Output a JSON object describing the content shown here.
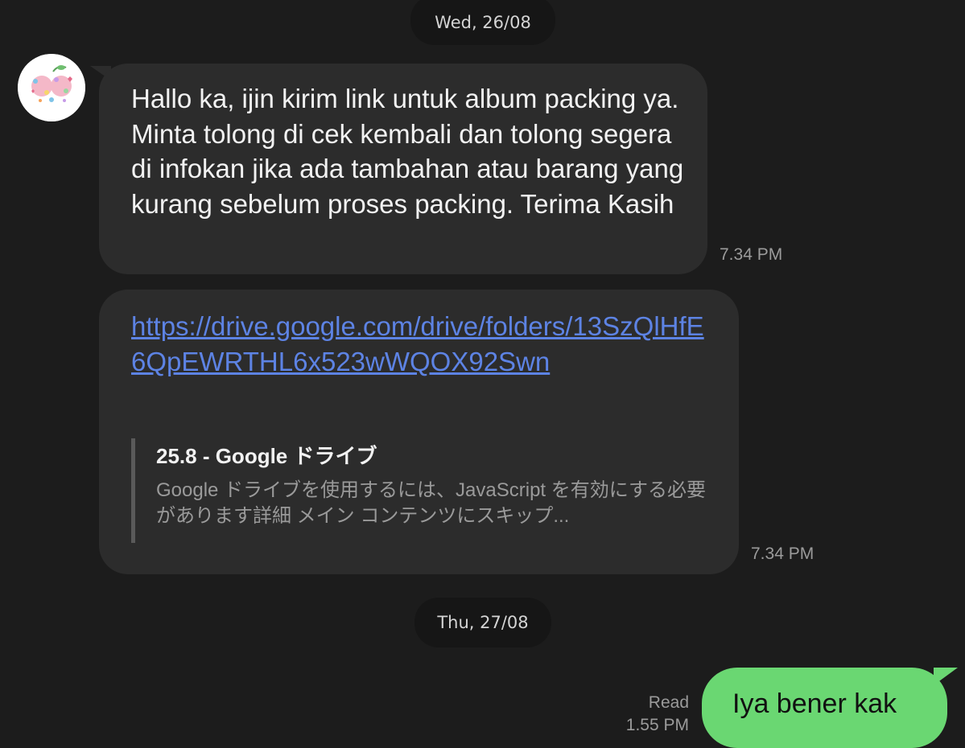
{
  "dates": {
    "first": "Wed, 26/08",
    "second": "Thu, 27/08"
  },
  "avatar": {
    "icon": "cherry-logo-avatar"
  },
  "messages": [
    {
      "direction": "incoming",
      "text": "Hallo ka, ijin kirim link untuk album packing ya. Minta tolong di cek kembali dan tolong segera di infokan jika ada tambahan atau barang yang kurang sebelum proses packing. Terima Kasih",
      "time": "7.34 PM"
    },
    {
      "direction": "incoming",
      "link": "https://drive.google.com/drive/folders/13SzQlHfE6QpEWRTHL6x523wWQOX92Swn",
      "preview": {
        "title": "25.8 - Google ドライブ",
        "description": "Google ドライブを使用するには、JavaScript を有効にする必要があります詳細 メイン コンテンツにスキップ..."
      },
      "time": "7.34 PM"
    },
    {
      "direction": "outgoing",
      "text": "Iya bener kak",
      "status": "Read",
      "time": "1.55 PM"
    }
  ],
  "colors": {
    "background": "#1c1c1c",
    "incoming_bubble": "#2c2c2c",
    "outgoing_bubble": "#6ad772",
    "link": "#5d83e4"
  }
}
